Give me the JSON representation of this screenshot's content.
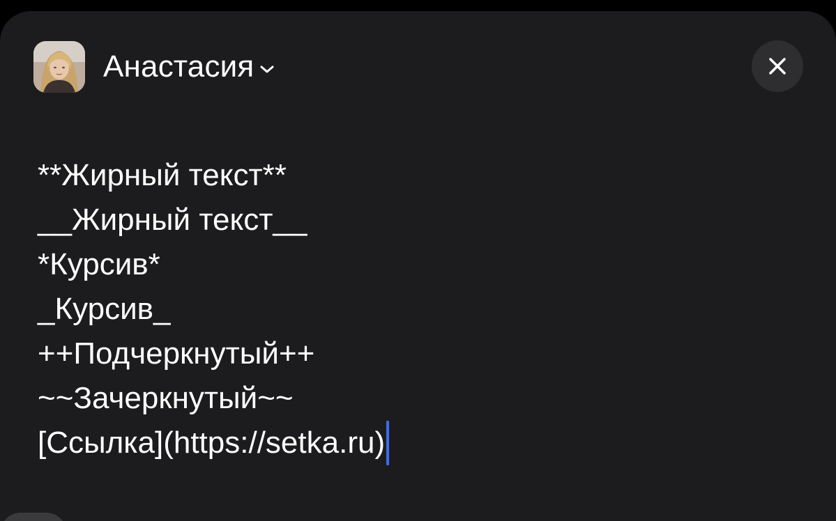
{
  "header": {
    "account_name": "Анастасия",
    "avatar_icon": "avatar-photo",
    "dropdown_icon": "chevron-down-icon",
    "close_icon": "close-icon"
  },
  "editor": {
    "lines": [
      "**Жирный текст**",
      "__Жирный текст__",
      "*Курсив*",
      "_Курсив_",
      "++Подчеркнутый++",
      "~~Зачеркнутый~~",
      "[Ссылка](https://setka.ru)"
    ],
    "caret_color": "#3a6cf4"
  },
  "colors": {
    "background": "#1c1c1e",
    "text": "#ffffff",
    "close_button_bg": "#2e2e31"
  }
}
